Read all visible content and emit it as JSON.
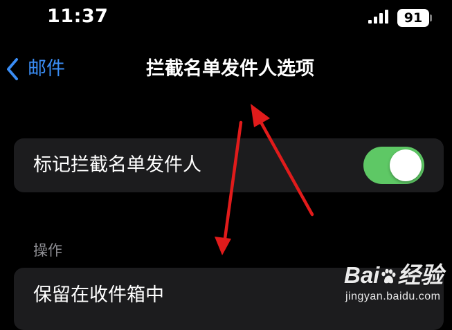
{
  "status_bar": {
    "time": "11:37",
    "battery_level": "91"
  },
  "nav": {
    "back_label": "邮件",
    "title": "拦截名单发件人选项"
  },
  "settings": {
    "mark_blocked": {
      "label": "标记拦截名单发件人",
      "enabled": true
    },
    "section_header": "操作",
    "option_label": "保留在收件箱中"
  },
  "watermark": {
    "logo_part1": "Bai",
    "logo_part2": "经验",
    "url": "jingyan.baidu.com"
  },
  "colors": {
    "background": "#000000",
    "cell_background": "#1c1c1e",
    "accent_blue": "#3a8df5",
    "toggle_on": "#5ec865",
    "annotation_red": "#e11b1b",
    "secondary_text": "#8e8e93"
  }
}
